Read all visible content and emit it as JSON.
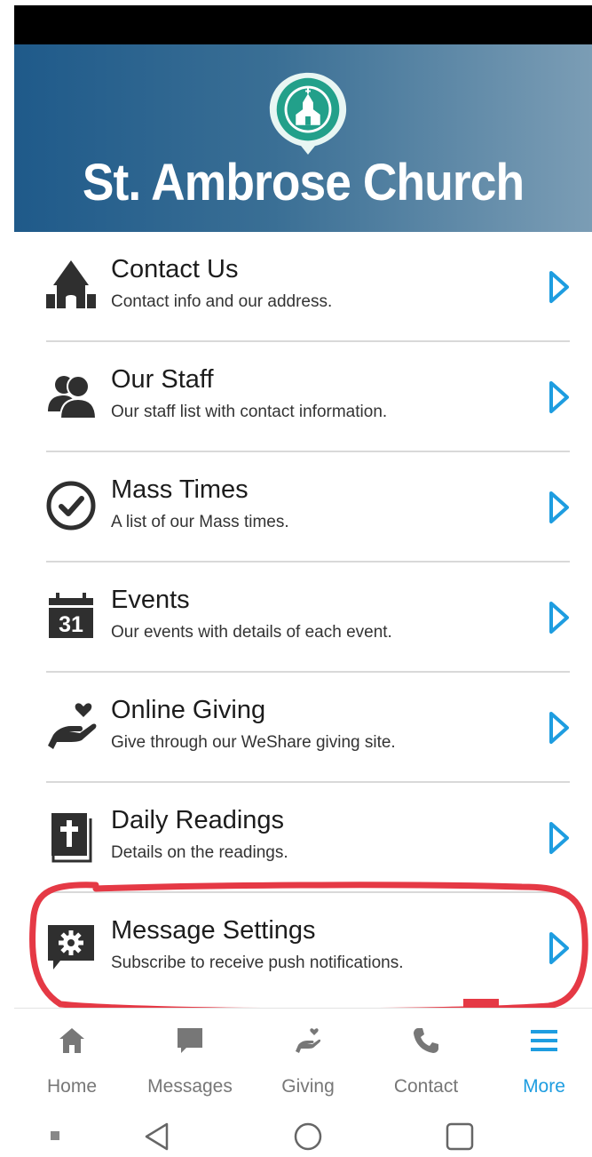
{
  "header": {
    "title": "St. Ambrose Church",
    "logo_icon": "church-pin-icon",
    "gradient_colors": [
      "#1f5a8a",
      "#7b9db5"
    ]
  },
  "menu": {
    "items": [
      {
        "title": "Contact Us",
        "subtitle": "Contact info and our address.",
        "icon": "church-icon"
      },
      {
        "title": "Our Staff",
        "subtitle": "Our staff list with contact information.",
        "icon": "people-icon"
      },
      {
        "title": "Mass Times",
        "subtitle": "A list of our Mass times.",
        "icon": "clock-check-icon"
      },
      {
        "title": "Events",
        "subtitle": "Our events with details of each event.",
        "icon": "calendar-icon",
        "calendar_day": "31"
      },
      {
        "title": "Online Giving",
        "subtitle": "Give through our WeShare giving site.",
        "icon": "giving-hand-icon"
      },
      {
        "title": "Daily Readings",
        "subtitle": "Details on the readings.",
        "icon": "bible-icon"
      },
      {
        "title": "Message Settings",
        "subtitle": "Subscribe to receive push notifications.",
        "icon": "message-gear-icon",
        "highlighted": true
      }
    ],
    "chevron_color": "#1e9de0",
    "highlight_color": "#e53945"
  },
  "tabs": [
    {
      "label": "Home",
      "icon": "home-icon"
    },
    {
      "label": "Messages",
      "icon": "chat-icon"
    },
    {
      "label": "Giving",
      "icon": "giving-icon"
    },
    {
      "label": "Contact",
      "icon": "phone-icon"
    },
    {
      "label": "More",
      "icon": "menu-icon",
      "active": true
    }
  ],
  "system_nav": [
    "recents-dot-icon",
    "back-icon",
    "home-circle-icon",
    "overview-square-icon"
  ]
}
